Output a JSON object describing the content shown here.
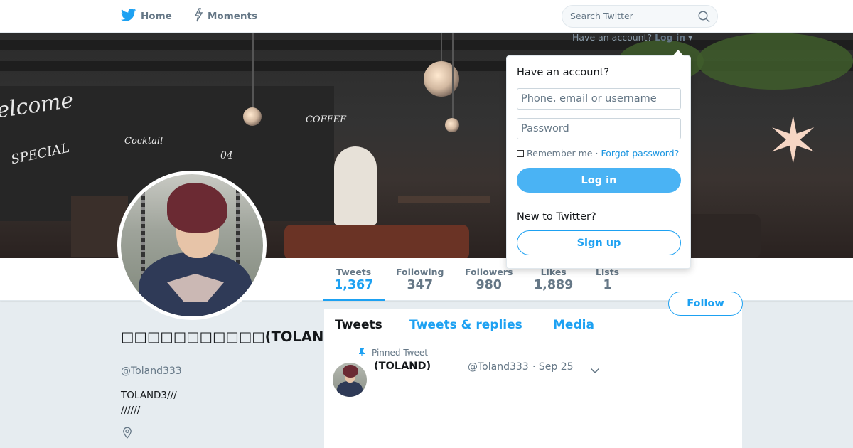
{
  "nav": {
    "home_label": "Home",
    "moments_label": "Moments",
    "search_placeholder": "Search Twitter"
  },
  "login_prompt": {
    "text": "Have an account?",
    "link": "Log in"
  },
  "login_panel": {
    "title": "Have an account?",
    "username_placeholder": "Phone, email or username",
    "password_placeholder": "Password",
    "remember_label": "Remember me",
    "separator": "·",
    "forgot_label": "Forgot password?",
    "login_button": "Log in",
    "new_label": "New to Twitter?",
    "signup_button": "Sign up"
  },
  "stats": [
    {
      "label": "Tweets",
      "value": "1,367",
      "active": true
    },
    {
      "label": "Following",
      "value": "347",
      "active": false
    },
    {
      "label": "Followers",
      "value": "980",
      "active": false
    },
    {
      "label": "Likes",
      "value": "1,889",
      "active": false
    },
    {
      "label": "Lists",
      "value": "1",
      "active": false
    }
  ],
  "follow_button": "Follow",
  "profile": {
    "name": "□□□□□□□□□□□(TOLAND□□□□□□□□□□)",
    "handle": "@Toland333",
    "bio": "TOLAND3///\n//////"
  },
  "timeline": {
    "tabs": [
      "Tweets",
      "Tweets & replies",
      "Media"
    ],
    "active_tab": "Tweets",
    "pinned_label": "Pinned Tweet",
    "tweet": {
      "name": "(TOLAND)",
      "handle": "@Toland333",
      "time": "· Sep 25"
    }
  },
  "colors": {
    "accent": "#1da1f2",
    "login_button": "#4ab3f4",
    "muted": "#657786",
    "page_bg": "#e6ecf0"
  },
  "icons": {
    "home": "twitter-bird-icon",
    "moments": "lightning-icon",
    "search": "search-icon",
    "pin": "pin-icon",
    "location": "location-pin-icon",
    "caret": "chevron-down-icon"
  }
}
